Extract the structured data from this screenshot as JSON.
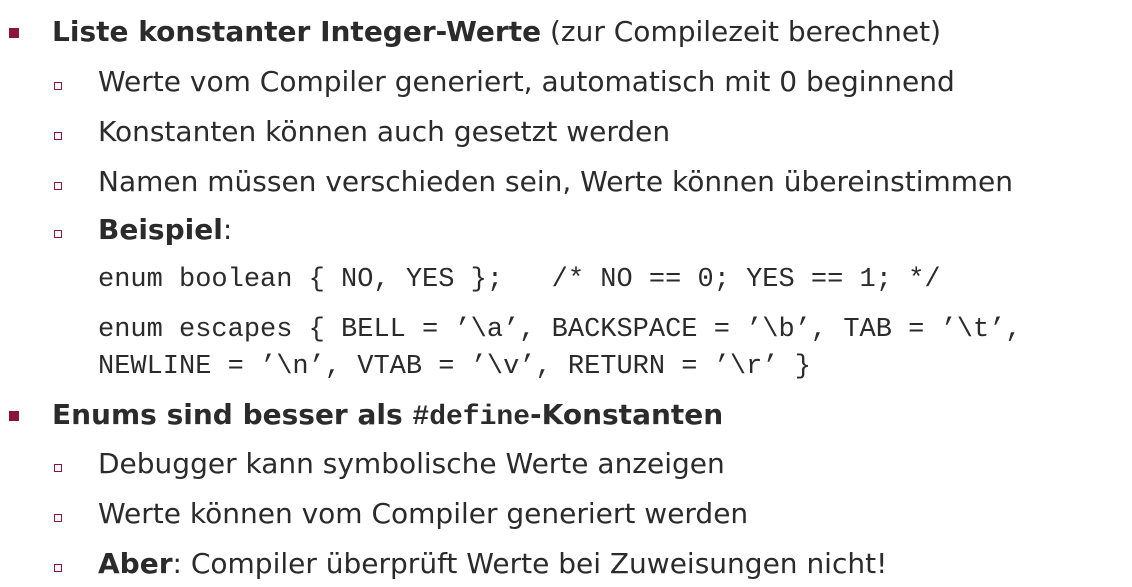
{
  "section1": {
    "heading_bold": "Liste konstanter Integer-Werte",
    "heading_rest": " (zur Compilezeit berechnet)",
    "items": [
      "Werte vom Compiler generiert, automatisch mit 0 beginnend",
      "Konstanten können auch gesetzt werden",
      "Namen müssen verschieden sein, Werte können übereinstimmen"
    ],
    "example_label": "Beispiel",
    "example_colon": ":",
    "code": [
      "enum boolean { NO, YES };   /* NO == 0; YES == 1; */",
      "enum escapes { BELL = ’\\a’, BACKSPACE = ’\\b’, TAB = ’\\t’,",
      "NEWLINE = ’\\n’, VTAB = ’\\v’, RETURN = ’\\r’ }"
    ]
  },
  "section2": {
    "heading_part1": "Enums sind besser als ",
    "heading_code": "#define",
    "heading_part2": "-Konstanten",
    "items": [
      "Debugger kann symbolische Werte anzeigen",
      "Werte können vom Compiler generiert werden"
    ],
    "last_item_bold": "Aber",
    "last_item_rest": ": Compiler überprüft Werte bei Zuweisungen nicht!"
  },
  "colors": {
    "bullet": "#8a1538",
    "text": "#2b2b2b"
  }
}
